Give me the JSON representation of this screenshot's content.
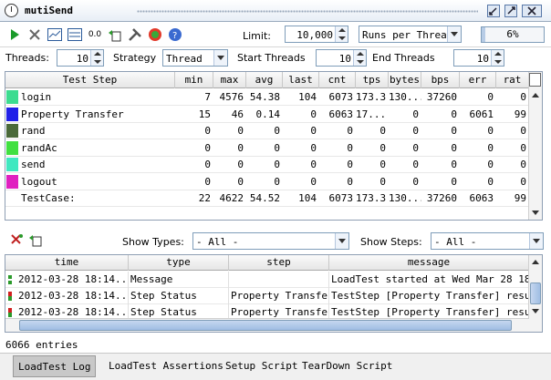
{
  "window": {
    "title": "mutiSend"
  },
  "toolbar": {
    "limit_label": "Limit:",
    "limit_value": "10,000",
    "limit_mode": "Runs per Thread",
    "progress_text": "6%",
    "progress_fraction": 0.06
  },
  "threads": {
    "threads_label": "Threads:",
    "threads_value": "10",
    "strategy_label": "Strategy",
    "strategy_value": "Thread",
    "start_label": "Start Threads",
    "start_value": "10",
    "end_label": "End Threads",
    "end_value": "10"
  },
  "stats": {
    "columns": [
      "Test Step",
      "min",
      "max",
      "avg",
      "last",
      "cnt",
      "tps",
      "bytes",
      "bps",
      "err",
      "rat"
    ],
    "rows": [
      {
        "name": "login",
        "color": "#3cdc90",
        "min": "7",
        "max": "4576",
        "avg": "54.38",
        "last": "104",
        "cnt": "6073",
        "tps": "173.3",
        "bytes": "130...",
        "bps": "37260",
        "err": "0",
        "rat": "0"
      },
      {
        "name": "Property Transfer",
        "color": "#2020e8",
        "min": "15",
        "max": "46",
        "avg": "0.14",
        "last": "0",
        "cnt": "6063",
        "tps": "17...",
        "bytes": "0",
        "bps": "0",
        "err": "6061",
        "rat": "99"
      },
      {
        "name": "rand",
        "color": "#4a6a3a",
        "min": "0",
        "max": "0",
        "avg": "0",
        "last": "0",
        "cnt": "0",
        "tps": "0",
        "bytes": "0",
        "bps": "0",
        "err": "0",
        "rat": "0"
      },
      {
        "name": "randAc",
        "color": "#40e040",
        "min": "0",
        "max": "0",
        "avg": "0",
        "last": "0",
        "cnt": "0",
        "tps": "0",
        "bytes": "0",
        "bps": "0",
        "err": "0",
        "rat": "0"
      },
      {
        "name": "send",
        "color": "#40e8c0",
        "min": "0",
        "max": "0",
        "avg": "0",
        "last": "0",
        "cnt": "0",
        "tps": "0",
        "bytes": "0",
        "bps": "0",
        "err": "0",
        "rat": "0"
      },
      {
        "name": "logout",
        "color": "#e020c0",
        "min": "0",
        "max": "0",
        "avg": "0",
        "last": "0",
        "cnt": "0",
        "tps": "0",
        "bytes": "0",
        "bps": "0",
        "err": "0",
        "rat": "0"
      },
      {
        "name": "TestCase:",
        "color": "",
        "min": "22",
        "max": "4622",
        "avg": "54.52",
        "last": "104",
        "cnt": "6073",
        "tps": "173.3",
        "bytes": "130...",
        "bps": "37260",
        "err": "6063",
        "rat": "99"
      }
    ]
  },
  "log_filter": {
    "types_label": "Show Types:",
    "types_value": "- All -",
    "steps_label": "Show Steps:",
    "steps_value": "- All -"
  },
  "log": {
    "columns": [
      "time",
      "type",
      "step",
      "message"
    ],
    "rows": [
      {
        "time": "2012-03-28 18:14...",
        "type": "Message",
        "step": "",
        "message": "LoadTest started at Wed Mar 28 18:14:",
        "level": "info"
      },
      {
        "time": "2012-03-28 18:14...",
        "type": "Step Status",
        "step": "Property Transfer",
        "message": "TestStep [Property Transfer] result s",
        "level": "error"
      },
      {
        "time": "2012-03-28 18:14...",
        "type": "Step Status",
        "step": "Property Transfer",
        "message": "TestStep [Property Transfer] result s",
        "level": "error"
      }
    ],
    "entries": "6066 entries"
  },
  "tabs": [
    "LoadTest Log",
    "LoadTest Assertions",
    "Setup Script",
    "TearDown Script"
  ],
  "active_tab": 0
}
